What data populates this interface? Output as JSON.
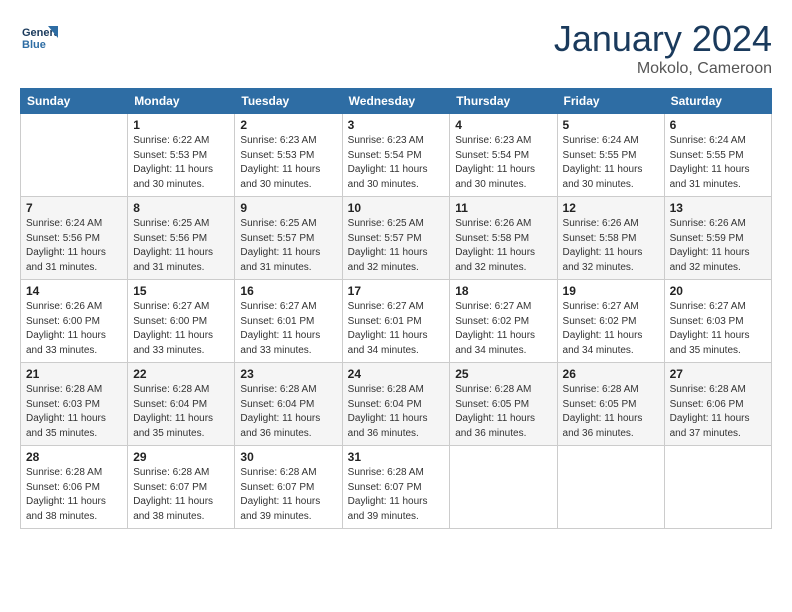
{
  "header": {
    "logo_line1": "General",
    "logo_line2": "Blue",
    "month": "January 2024",
    "location": "Mokolo, Cameroon"
  },
  "weekdays": [
    "Sunday",
    "Monday",
    "Tuesday",
    "Wednesday",
    "Thursday",
    "Friday",
    "Saturday"
  ],
  "weeks": [
    [
      {
        "day": "",
        "sunrise": "",
        "sunset": "",
        "daylight": ""
      },
      {
        "day": "1",
        "sunrise": "6:22 AM",
        "sunset": "5:53 PM",
        "daylight": "11 hours and 30 minutes."
      },
      {
        "day": "2",
        "sunrise": "6:23 AM",
        "sunset": "5:53 PM",
        "daylight": "11 hours and 30 minutes."
      },
      {
        "day": "3",
        "sunrise": "6:23 AM",
        "sunset": "5:54 PM",
        "daylight": "11 hours and 30 minutes."
      },
      {
        "day": "4",
        "sunrise": "6:23 AM",
        "sunset": "5:54 PM",
        "daylight": "11 hours and 30 minutes."
      },
      {
        "day": "5",
        "sunrise": "6:24 AM",
        "sunset": "5:55 PM",
        "daylight": "11 hours and 30 minutes."
      },
      {
        "day": "6",
        "sunrise": "6:24 AM",
        "sunset": "5:55 PM",
        "daylight": "11 hours and 31 minutes."
      }
    ],
    [
      {
        "day": "7",
        "sunrise": "6:24 AM",
        "sunset": "5:56 PM",
        "daylight": "11 hours and 31 minutes."
      },
      {
        "day": "8",
        "sunrise": "6:25 AM",
        "sunset": "5:56 PM",
        "daylight": "11 hours and 31 minutes."
      },
      {
        "day": "9",
        "sunrise": "6:25 AM",
        "sunset": "5:57 PM",
        "daylight": "11 hours and 31 minutes."
      },
      {
        "day": "10",
        "sunrise": "6:25 AM",
        "sunset": "5:57 PM",
        "daylight": "11 hours and 32 minutes."
      },
      {
        "day": "11",
        "sunrise": "6:26 AM",
        "sunset": "5:58 PM",
        "daylight": "11 hours and 32 minutes."
      },
      {
        "day": "12",
        "sunrise": "6:26 AM",
        "sunset": "5:58 PM",
        "daylight": "11 hours and 32 minutes."
      },
      {
        "day": "13",
        "sunrise": "6:26 AM",
        "sunset": "5:59 PM",
        "daylight": "11 hours and 32 minutes."
      }
    ],
    [
      {
        "day": "14",
        "sunrise": "6:26 AM",
        "sunset": "6:00 PM",
        "daylight": "11 hours and 33 minutes."
      },
      {
        "day": "15",
        "sunrise": "6:27 AM",
        "sunset": "6:00 PM",
        "daylight": "11 hours and 33 minutes."
      },
      {
        "day": "16",
        "sunrise": "6:27 AM",
        "sunset": "6:01 PM",
        "daylight": "11 hours and 33 minutes."
      },
      {
        "day": "17",
        "sunrise": "6:27 AM",
        "sunset": "6:01 PM",
        "daylight": "11 hours and 34 minutes."
      },
      {
        "day": "18",
        "sunrise": "6:27 AM",
        "sunset": "6:02 PM",
        "daylight": "11 hours and 34 minutes."
      },
      {
        "day": "19",
        "sunrise": "6:27 AM",
        "sunset": "6:02 PM",
        "daylight": "11 hours and 34 minutes."
      },
      {
        "day": "20",
        "sunrise": "6:27 AM",
        "sunset": "6:03 PM",
        "daylight": "11 hours and 35 minutes."
      }
    ],
    [
      {
        "day": "21",
        "sunrise": "6:28 AM",
        "sunset": "6:03 PM",
        "daylight": "11 hours and 35 minutes."
      },
      {
        "day": "22",
        "sunrise": "6:28 AM",
        "sunset": "6:04 PM",
        "daylight": "11 hours and 35 minutes."
      },
      {
        "day": "23",
        "sunrise": "6:28 AM",
        "sunset": "6:04 PM",
        "daylight": "11 hours and 36 minutes."
      },
      {
        "day": "24",
        "sunrise": "6:28 AM",
        "sunset": "6:04 PM",
        "daylight": "11 hours and 36 minutes."
      },
      {
        "day": "25",
        "sunrise": "6:28 AM",
        "sunset": "6:05 PM",
        "daylight": "11 hours and 36 minutes."
      },
      {
        "day": "26",
        "sunrise": "6:28 AM",
        "sunset": "6:05 PM",
        "daylight": "11 hours and 36 minutes."
      },
      {
        "day": "27",
        "sunrise": "6:28 AM",
        "sunset": "6:06 PM",
        "daylight": "11 hours and 37 minutes."
      }
    ],
    [
      {
        "day": "28",
        "sunrise": "6:28 AM",
        "sunset": "6:06 PM",
        "daylight": "11 hours and 38 minutes."
      },
      {
        "day": "29",
        "sunrise": "6:28 AM",
        "sunset": "6:07 PM",
        "daylight": "11 hours and 38 minutes."
      },
      {
        "day": "30",
        "sunrise": "6:28 AM",
        "sunset": "6:07 PM",
        "daylight": "11 hours and 39 minutes."
      },
      {
        "day": "31",
        "sunrise": "6:28 AM",
        "sunset": "6:07 PM",
        "daylight": "11 hours and 39 minutes."
      },
      {
        "day": "",
        "sunrise": "",
        "sunset": "",
        "daylight": ""
      },
      {
        "day": "",
        "sunrise": "",
        "sunset": "",
        "daylight": ""
      },
      {
        "day": "",
        "sunrise": "",
        "sunset": "",
        "daylight": ""
      }
    ]
  ]
}
